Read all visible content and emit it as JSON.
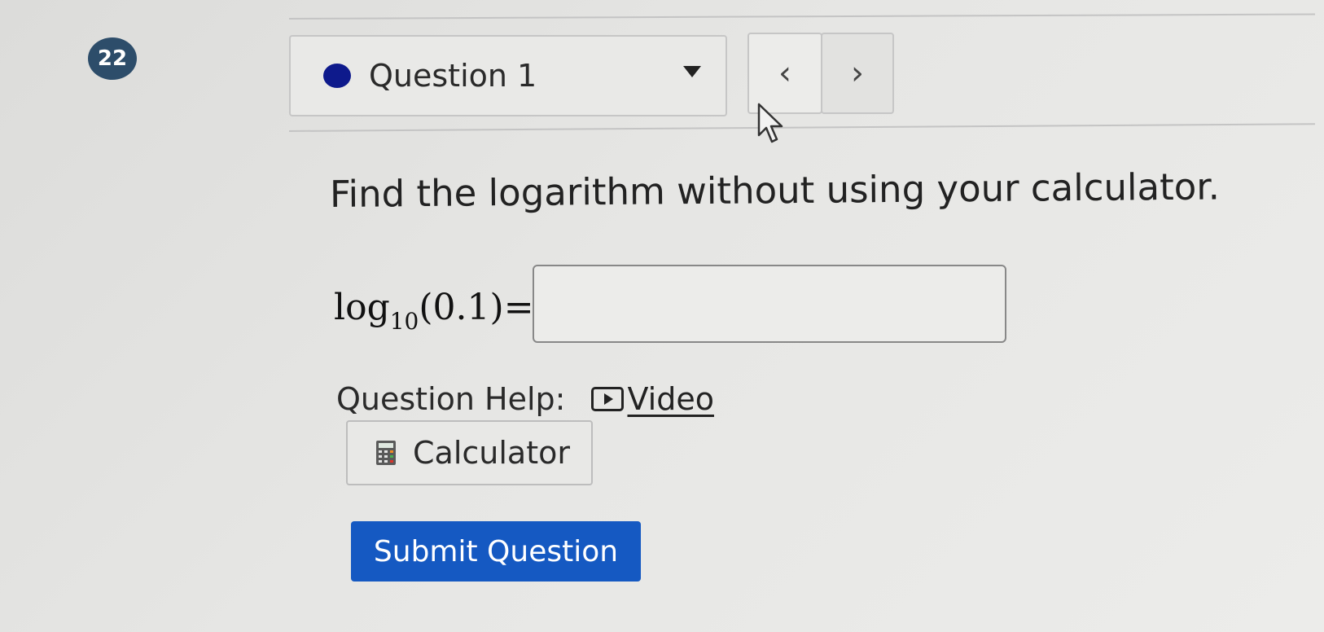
{
  "question_number_badge": "22",
  "question_selector": {
    "selected": "Question 1",
    "status_color": "#0e1a8c"
  },
  "nav": {
    "prev_label": "‹",
    "next_label": "›"
  },
  "prompt": "Find the logarithm without using your calculator.",
  "equation": {
    "function": "log",
    "base": "10",
    "argument": "(0.1)",
    "equals": "="
  },
  "answer_input": {
    "value": "",
    "placeholder": ""
  },
  "help": {
    "label": "Question Help:",
    "video_label": "Video"
  },
  "calculator_button": {
    "label": "Calculator",
    "icon": "calculator-icon"
  },
  "submit_button": {
    "label": "Submit Question",
    "color": "#1559c2"
  }
}
